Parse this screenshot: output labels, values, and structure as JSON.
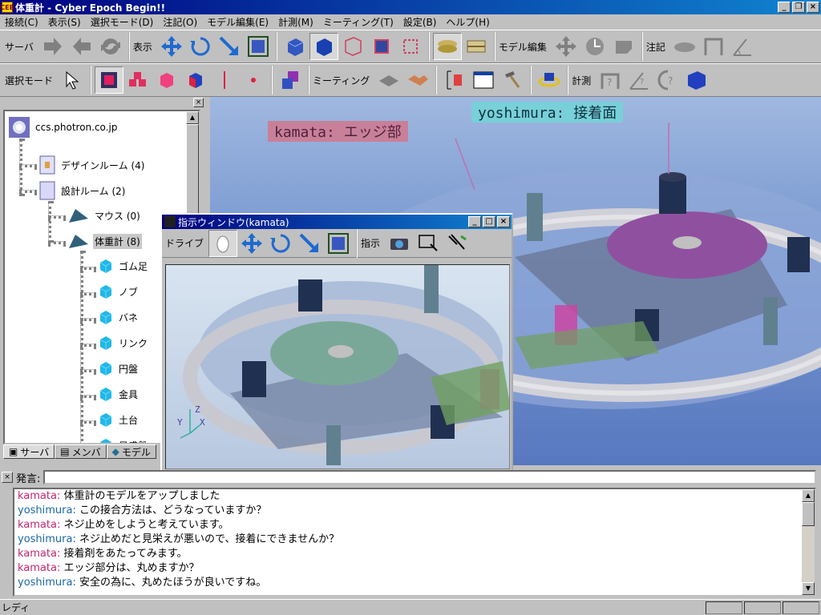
{
  "window": {
    "title": "体重計 - Cyber Epoch Begin!!",
    "app_icon": "CEB"
  },
  "menu": [
    "接続(C)",
    "表示(S)",
    "選択モード(D)",
    "注記(O)",
    "モデル編集(E)",
    "計測(M)",
    "ミーティング(T)",
    "設定(B)",
    "ヘルプ(H)"
  ],
  "toolbar1": {
    "server_label": "サーバ",
    "display_label": "表示",
    "model_edit_label": "モデル編集",
    "annotation_label": "注記"
  },
  "toolbar2": {
    "select_mode_label": "選択モード",
    "meeting_label": "ミーティング",
    "measure_label": "計測"
  },
  "tree": {
    "root": "ccs.photron.co.jp",
    "rooms": [
      {
        "label": "デザインルーム (4)"
      },
      {
        "label": "設計ルーム (2)"
      }
    ],
    "models": [
      {
        "label": "マウス (0)"
      },
      {
        "label": "体重計 (8)"
      }
    ],
    "parts": [
      "ゴム足",
      "ノブ",
      "バネ",
      "リンク",
      "円盤",
      "金具",
      "土台",
      "目盛盤"
    ]
  },
  "left_tabs": [
    "サーバ",
    "メンバ",
    "モデル"
  ],
  "callouts": {
    "kamata": "kamata: エッジ部",
    "yoshimura": "yoshimura: 接着面"
  },
  "subwindow": {
    "title": "指示ウィンドウ(kamata)",
    "drive_label": "ドライブ",
    "indicate_label": "指示"
  },
  "chat": {
    "input_label": "発言:",
    "input_value": "",
    "messages": [
      {
        "name": "kamata",
        "text": "体重計のモデルをアップしました"
      },
      {
        "name": "yoshimura",
        "text": "この接合方法は、どうなっていますか？"
      },
      {
        "name": "kamata",
        "text": "ネジ止めをしようと考えています。"
      },
      {
        "name": "yoshimura",
        "text": "ネジ止めだと見栄えが悪いので、接着にできませんか？"
      },
      {
        "name": "kamata",
        "text": "接着剤をあたってみます。"
      },
      {
        "name": "kamata",
        "text": "エッジ部分は、丸めますか？"
      },
      {
        "name": "yoshimura",
        "text": "安全の為に、丸めたほうが良いですね。"
      }
    ]
  },
  "status": {
    "text": "レディ"
  },
  "colors": {
    "title_gradient_start": "#000080",
    "kamata_name": "#c02870",
    "yoshimura_name": "#1868a8",
    "kamata_callout": "#c88098",
    "yoshimura_callout": "#78d0d8"
  }
}
